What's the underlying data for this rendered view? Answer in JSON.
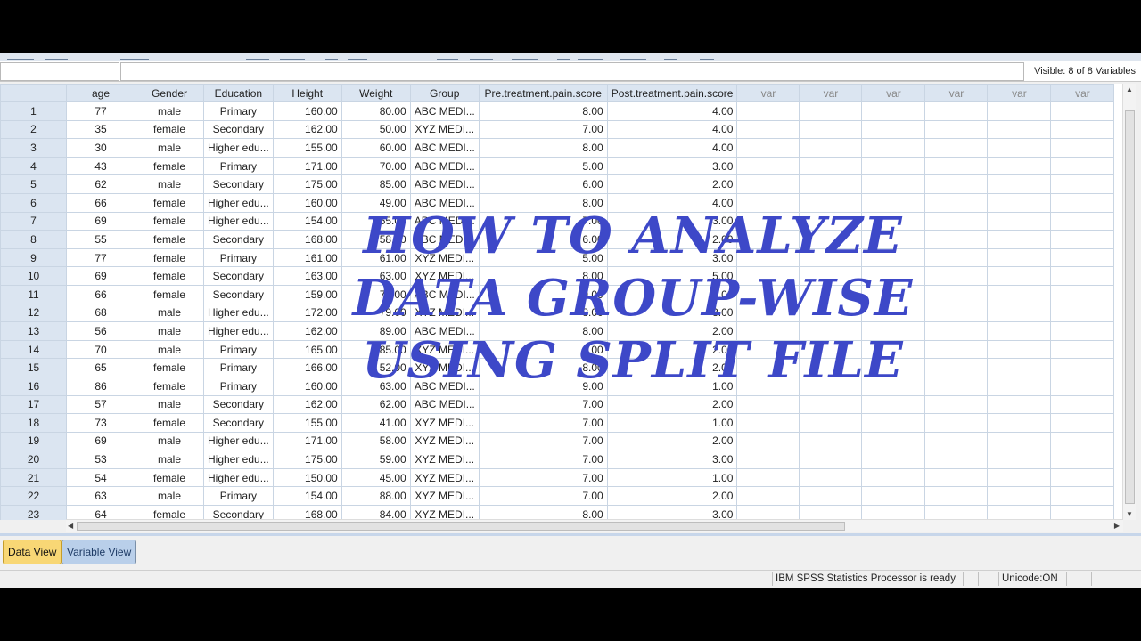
{
  "status_bar": {
    "visible_label": "Visible: 8 of 8 Variables",
    "processor": "IBM SPSS Statistics Processor is ready",
    "unicode": "Unicode:ON"
  },
  "tabs": {
    "data_view": "Data View",
    "variable_view": "Variable View"
  },
  "columns": [
    "age",
    "Gender",
    "Education",
    "Height",
    "Weight",
    "Group",
    "Pre.treatment.pain.score",
    "Post.treatment.pain.score",
    "var",
    "var",
    "var",
    "var",
    "var",
    "var"
  ],
  "rows": [
    [
      "1",
      "77",
      "male",
      "Primary",
      "160.00",
      "80.00",
      "ABC MEDI...",
      "8.00",
      "4.00"
    ],
    [
      "2",
      "35",
      "female",
      "Secondary",
      "162.00",
      "50.00",
      "XYZ MEDI...",
      "7.00",
      "4.00"
    ],
    [
      "3",
      "30",
      "male",
      "Higher edu...",
      "155.00",
      "60.00",
      "ABC MEDI...",
      "8.00",
      "4.00"
    ],
    [
      "4",
      "43",
      "female",
      "Primary",
      "171.00",
      "70.00",
      "ABC MEDI...",
      "5.00",
      "3.00"
    ],
    [
      "5",
      "62",
      "male",
      "Secondary",
      "175.00",
      "85.00",
      "ABC MEDI...",
      "6.00",
      "2.00"
    ],
    [
      "6",
      "66",
      "female",
      "Higher edu...",
      "160.00",
      "49.00",
      "ABC MEDI...",
      "8.00",
      "4.00"
    ],
    [
      "7",
      "69",
      "female",
      "Higher edu...",
      "154.00",
      "55.00",
      "ABC MEDI...",
      "7.00",
      "3.00"
    ],
    [
      "8",
      "55",
      "female",
      "Secondary",
      "168.00",
      "58.00",
      "ABC MEDI...",
      "6.00",
      "2.00"
    ],
    [
      "9",
      "77",
      "female",
      "Primary",
      "161.00",
      "61.00",
      "XYZ MEDI...",
      "5.00",
      "3.00"
    ],
    [
      "10",
      "69",
      "female",
      "Secondary",
      "163.00",
      "63.00",
      "XYZ MEDI...",
      "8.00",
      "5.00"
    ],
    [
      "11",
      "66",
      "female",
      "Secondary",
      "159.00",
      "75.00",
      "ABC MEDI...",
      "9.00",
      "4.00"
    ],
    [
      "12",
      "68",
      "male",
      "Higher edu...",
      "172.00",
      "79.00",
      "XYZ MEDI...",
      "8.00",
      "3.00"
    ],
    [
      "13",
      "56",
      "male",
      "Higher edu...",
      "162.00",
      "89.00",
      "ABC MEDI...",
      "8.00",
      "2.00"
    ],
    [
      "14",
      "70",
      "male",
      "Primary",
      "165.00",
      "85.00",
      "XYZ MEDI...",
      "8.00",
      "2.00"
    ],
    [
      "15",
      "65",
      "female",
      "Primary",
      "166.00",
      "52.00",
      "XYZ MEDI...",
      "8.00",
      "2.00"
    ],
    [
      "16",
      "86",
      "female",
      "Primary",
      "160.00",
      "63.00",
      "ABC MEDI...",
      "9.00",
      "1.00"
    ],
    [
      "17",
      "57",
      "male",
      "Secondary",
      "162.00",
      "62.00",
      "ABC MEDI...",
      "7.00",
      "2.00"
    ],
    [
      "18",
      "73",
      "female",
      "Secondary",
      "155.00",
      "41.00",
      "XYZ MEDI...",
      "7.00",
      "1.00"
    ],
    [
      "19",
      "69",
      "male",
      "Higher edu...",
      "171.00",
      "58.00",
      "XYZ MEDI...",
      "7.00",
      "2.00"
    ],
    [
      "20",
      "53",
      "male",
      "Higher edu...",
      "175.00",
      "59.00",
      "XYZ MEDI...",
      "7.00",
      "3.00"
    ],
    [
      "21",
      "54",
      "female",
      "Higher edu...",
      "150.00",
      "45.00",
      "XYZ MEDI...",
      "7.00",
      "1.00"
    ],
    [
      "22",
      "63",
      "male",
      "Primary",
      "154.00",
      "88.00",
      "XYZ MEDI...",
      "7.00",
      "2.00"
    ],
    [
      "23",
      "64",
      "female",
      "Secondary",
      "168.00",
      "84.00",
      "XYZ MEDI...",
      "8.00",
      "3.00"
    ]
  ],
  "overlay": {
    "line1": "HOW TO ANALYZE",
    "line2": "DATA GROUP-WISE",
    "line3": "USING SPLIT FILE"
  },
  "colors": {
    "header_bg": "#dbe5f1",
    "active_tab": "#f8d775",
    "inactive_tab": "#b9cfea",
    "overlay_text": "#3d48c8"
  }
}
